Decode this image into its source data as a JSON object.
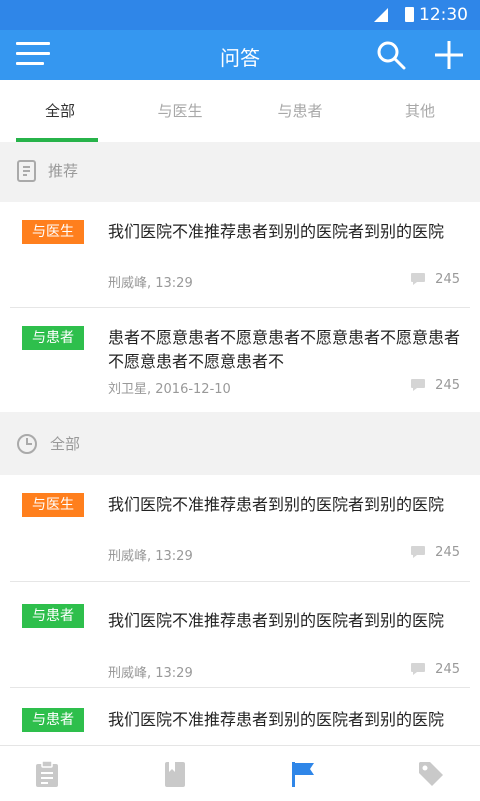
{
  "status_bar": {
    "time": "12:30"
  },
  "app_bar": {
    "title": "问答"
  },
  "tabs": [
    {
      "label": "全部",
      "active": true
    },
    {
      "label": "与医生"
    },
    {
      "label": "与患者"
    },
    {
      "label": "其他"
    }
  ],
  "sections": {
    "recommended": {
      "label": "推荐"
    },
    "all": {
      "label": "全部"
    }
  },
  "recommended_items": [
    {
      "badge": "与医生",
      "title": "我们医院不准推荐患者到别的医院者到别的医院",
      "meta": "刑威峰, 13:29",
      "comments": "245"
    },
    {
      "badge": "与患者",
      "title": "患者不愿意患者不愿意患者不愿意患者不愿意患者不愿意患者不愿意患者不",
      "meta": "刘卫星, 2016-12-10",
      "comments": "245"
    }
  ],
  "all_items": [
    {
      "badge": "与医生",
      "title": "我们医院不准推荐患者到别的医院者到别的医院",
      "meta": "刑威峰, 13:29",
      "comments": "245"
    },
    {
      "badge": "与患者",
      "title": "我们医院不准推荐患者到别的医院者到别的医院",
      "meta": "刑威峰, 13:29",
      "comments": "245"
    },
    {
      "badge": "与患者",
      "title": "我们医院不准推荐患者到别的医院者到别的医院"
    }
  ],
  "colors": {
    "primary": "#3597f0",
    "status_bar": "#2f86e8",
    "doctor_badge": "#ff7f1d",
    "patient_badge": "#2ebf4c",
    "tab_indicator": "#27b34a",
    "nav_active": "#2f86e8",
    "nav_inactive": "#c9c9c9"
  },
  "bottom_nav": [
    {
      "icon": "clipboard-icon"
    },
    {
      "icon": "book-icon"
    },
    {
      "icon": "flag-icon",
      "active": true
    },
    {
      "icon": "tag-icon"
    }
  ]
}
